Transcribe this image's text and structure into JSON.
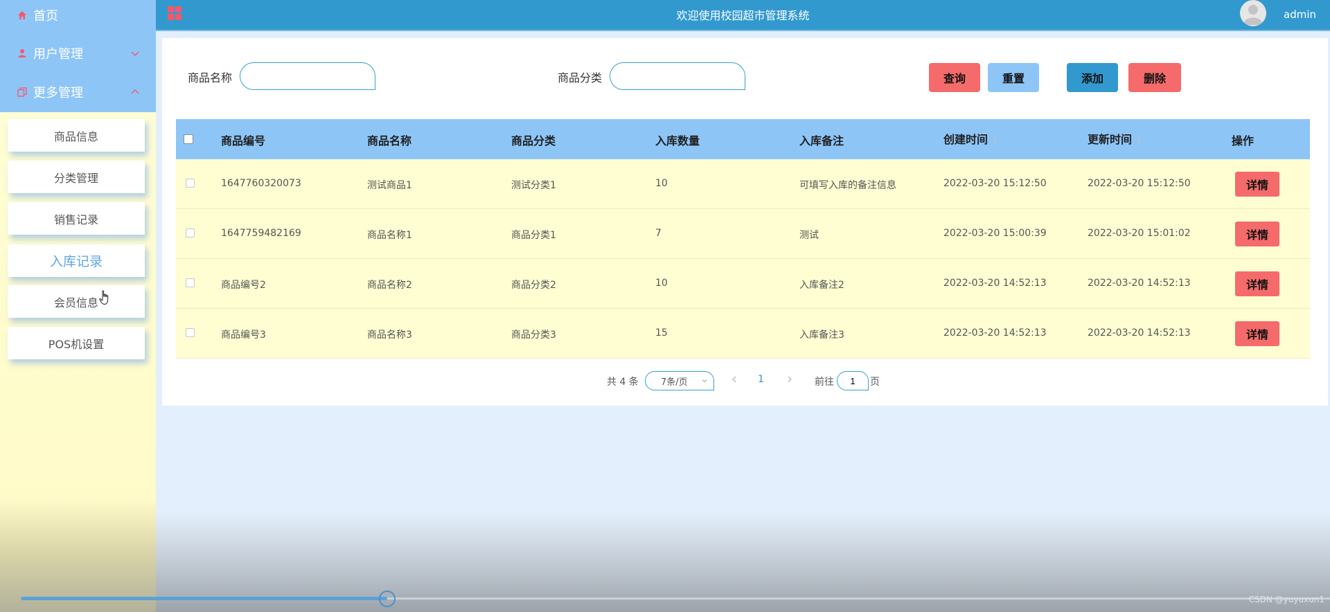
{
  "header": {
    "title": "欢迎使用校园超市管理系统",
    "username": "admin"
  },
  "sidebar": {
    "nav": [
      {
        "label": "首页"
      },
      {
        "label": "用户管理"
      },
      {
        "label": "更多管理"
      }
    ],
    "sub_items": [
      {
        "label": "商品信息"
      },
      {
        "label": "分类管理"
      },
      {
        "label": "销售记录"
      },
      {
        "label": "入库记录",
        "active": true
      },
      {
        "label": "会员信息"
      },
      {
        "label": "POS机设置"
      }
    ]
  },
  "search": {
    "name_label": "商品名称",
    "name_value": "",
    "category_label": "商品分类",
    "category_value": ""
  },
  "buttons": {
    "query": "查询",
    "reset": "重置",
    "add": "添加",
    "delete": "删除"
  },
  "table": {
    "headers": [
      "商品编号",
      "商品名称",
      "商品分类",
      "入库数量",
      "入库备注",
      "创建时间",
      "更新时间",
      "操作"
    ],
    "rows": [
      {
        "code": "1647760320073",
        "name": "测试商品1",
        "category": "测试分类1",
        "qty": "10",
        "note": "可填写入库的备注信息",
        "created": "2022-03-20 15:12:50",
        "updated": "2022-03-20 15:12:50"
      },
      {
        "code": "1647759482169",
        "name": "商品名称1",
        "category": "商品分类1",
        "qty": "7",
        "note": "测试",
        "created": "2022-03-20 15:00:39",
        "updated": "2022-03-20 15:01:02"
      },
      {
        "code": "商品编号2",
        "name": "商品名称2",
        "category": "商品分类2",
        "qty": "10",
        "note": "入库备注2",
        "created": "2022-03-20 14:52:13",
        "updated": "2022-03-20 14:52:13"
      },
      {
        "code": "商品编号3",
        "name": "商品名称3",
        "category": "商品分类3",
        "qty": "15",
        "note": "入库备注3",
        "created": "2022-03-20 14:52:13",
        "updated": "2022-03-20 14:52:13"
      }
    ],
    "detail_label": "详情"
  },
  "pagination": {
    "total_text": "共 4 条",
    "page_size": "7条/页",
    "current_page": "1",
    "goto_prefix": "前往",
    "goto_value": "1",
    "goto_suffix": "页"
  },
  "slider": {
    "progress": 0.28
  },
  "watermark": "CSDN @yuyuxun1",
  "colors": {
    "header": "#3299cf",
    "sidebar_top": "#8ec5f7",
    "table_header": "#8ec5f7",
    "row": "#fffed3",
    "danger": "#f56b6b",
    "primary": "#3299cf",
    "reset": "#8ec5f7"
  }
}
